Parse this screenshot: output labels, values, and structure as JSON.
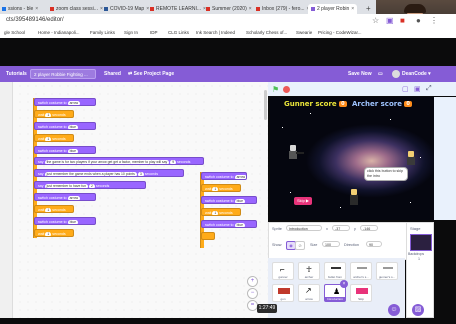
{
  "browser": {
    "tabs": [
      {
        "label": "ssions - ble",
        "color": "#1a73e8"
      },
      {
        "label": "zoom class sessi...",
        "color": "#d93025"
      },
      {
        "label": "COVID-19 Map",
        "color": "#2b5797"
      },
      {
        "label": "REMOTE LEARNI...",
        "color": "#d93025"
      },
      {
        "label": "Summer (2020)",
        "color": "#d93025"
      },
      {
        "label": "Inbox (279) - fero...",
        "color": "#d93025"
      },
      {
        "label": "2 player Robin",
        "color": "#855cd6"
      }
    ],
    "new_tab": "+",
    "url": "cts/395489146/editor/",
    "bookmarks": [
      "gle School",
      "Home - Indianapoli...",
      "Family Links",
      "Sign In",
      "IDP",
      "CLG Links",
      "Ink Search | Indeed",
      "Scholarly Chess of...",
      "Swearie",
      "Pricing - CodeWizar..."
    ]
  },
  "scratch": {
    "tutorials": "Tutorials",
    "project_title": "2 player Robbie Fighting ...",
    "share": "Shared",
    "see_project": "See Project Page",
    "save_now": "Save Now",
    "username": "DeanCode",
    "accent": "#855cd6"
  },
  "code_blocks": [
    {
      "text": "switch costume to",
      "value": "arrow"
    },
    {
      "text": "wait",
      "value": "1",
      "suffix": "seconds"
    },
    {
      "text": "switch costume to",
      "value": "blue"
    },
    {
      "text": "wait",
      "value": "1",
      "suffix": "seconds"
    },
    {
      "text": "switch costume to",
      "value": "blue"
    },
    {
      "text": "say",
      "value": "the game is for two players if your arrow get get a factor, member to play will say",
      "suffix": "seconds"
    },
    {
      "text": "say",
      "value": "just remember the game ends when a player has 10 points",
      "suffix": "seconds"
    },
    {
      "text": "say",
      "value": "just remember to have fun",
      "suffix": "seconds"
    },
    {
      "text": "switch costume to",
      "value": "arrow"
    },
    {
      "text": "wait",
      "value": "1",
      "suffix": "seconds"
    },
    {
      "text": "switch costume to",
      "value": "blue"
    },
    {
      "text": "wait",
      "value": "1",
      "suffix": "seconds"
    }
  ],
  "side_blocks": [
    {
      "text": "switch costume to",
      "value": "arrow"
    },
    {
      "text": "wait",
      "value": "1",
      "suffix": "seconds"
    },
    {
      "text": "switch costume to",
      "value": "blue"
    },
    {
      "text": "wait",
      "value": "1",
      "suffix": "seconds"
    },
    {
      "text": "switch costume to",
      "value": "blue"
    }
  ],
  "stage": {
    "gunner_label": "Gunner score",
    "gunner_value": "0",
    "archer_label": "Archer score",
    "archer_value": "0",
    "speech": "click this button to skip the intro",
    "skip_button": "Skip"
  },
  "sprite_info": {
    "sprite_label": "Sprite",
    "sprite_name": "Introduction",
    "x_label": "x",
    "x_value": "-37",
    "y_label": "y",
    "y_value": "-146",
    "show_label": "Show",
    "size_label": "Size",
    "size_value": "100",
    "direction_label": "Direction",
    "direction_value": "90"
  },
  "sprites": [
    {
      "name": "gunner"
    },
    {
      "name": "archer"
    },
    {
      "name": "bullet from"
    },
    {
      "name": "archer's s..."
    },
    {
      "name": "gunner's s..."
    },
    {
      "name": "gun"
    },
    {
      "name": "arrow"
    },
    {
      "name": "Introduction"
    },
    {
      "name": "Skip"
    }
  ],
  "stage_panel": {
    "label": "Stage",
    "backdrops_label": "Backdrops",
    "backdrop_count": "1"
  },
  "video": {
    "time": "1:27:49"
  }
}
